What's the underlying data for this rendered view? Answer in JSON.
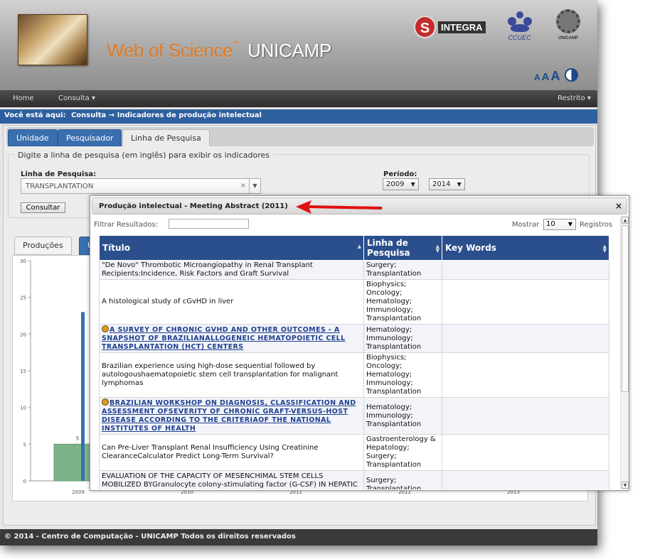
{
  "header": {
    "site_title_part1": "Web of Science",
    "site_title_tm": "™",
    "site_title_part2": "UNICAMP",
    "integra_label": "INTEGRA",
    "integra_letter": "S",
    "ccuec_label": "CCUEC",
    "unicamp_label": "UNICAMP",
    "font_small": "A",
    "font_medium": "A",
    "font_large": "A"
  },
  "nav": {
    "home": "Home",
    "consulta": "Consulta ▾",
    "restrito": "Restrito ▾"
  },
  "breadcrumb": {
    "prefix": "Você está aqui:",
    "path": "Consulta → Indicadores de produção intelectual"
  },
  "tabs": [
    "Unidade",
    "Pesquisador",
    "Linha de Pesquisa"
  ],
  "form": {
    "legend": "Digite a linha de pesquisa (em inglês) para exibir os indicadores",
    "linha_label": "Linha de Pesquisa:",
    "linha_value": "TRANSPLANTATION",
    "periodo_label": "Período:",
    "year_from": "2009",
    "year_to": "2014",
    "consultar_label": "Consultar",
    "clear_glyph": "×",
    "dropdown_glyph": "▼"
  },
  "chart_tabs": {
    "producoes": "Produções",
    "partial": "U"
  },
  "chart_data": {
    "type": "bar",
    "categories": [
      "2009",
      "2010",
      "2011",
      "2012",
      "2013"
    ],
    "values": [
      5,
      null,
      null,
      null,
      null
    ],
    "value_labels": [
      "5",
      "",
      "",
      "",
      ""
    ],
    "ylim": [
      0,
      30
    ],
    "yticks": [
      0,
      5,
      10,
      15,
      20,
      25,
      30
    ],
    "bar_color": "#7db38a",
    "grid": false
  },
  "footer": {
    "text": "© 2014 - Centro de Computação - UNICAMP Todos os direitos reservados"
  },
  "modal": {
    "title": "Produção intelectual - Meeting Abstract (2011)",
    "close": "×",
    "filter_label": "Filtrar Resultados:",
    "filter_value": "",
    "mostrar_label": "Mostrar",
    "mostrar_value": "10",
    "registros_label": "Registros",
    "columns": [
      "Título",
      "Linha de Pesquisa",
      "Key Words"
    ],
    "rows": [
      {
        "title": "\"De Novo\" Thrombotic Microangiopathy in Renal Transplant Recipients:Incidence, Risk Factors and Graft Survival",
        "linha": "Surgery; Transplantation",
        "keywords": "",
        "link": false
      },
      {
        "title": "A histological study of cGvHD in liver",
        "linha": "Biophysics; Oncology; Hematology; Immunology; Transplantation",
        "keywords": "",
        "link": false
      },
      {
        "title": "A SURVEY OF CHRONIC GVHD AND OTHER OUTCOMES - A SNAPSHOT OF BRAZILIANALLOGENEIC HEMATOPOIETIC CELL TRANSPLANTATION (HCT) CENTERS",
        "linha": "Hematology; Immunology; Transplantation",
        "keywords": "",
        "link": true
      },
      {
        "title": "Brazilian experience using high-dose sequential followed by autologoushaematopoietic stem cell transplantation for malignant lymphomas",
        "linha": "Biophysics; Oncology; Hematology; Immunology; Transplantation",
        "keywords": "",
        "link": false
      },
      {
        "title": "BRAZILIAN WORKSHOP ON DIAGNOSIS, CLASSIFICATION AND ASSESSMENT OFSEVERITY OF CHRONIC GRAFT-VERSUS-HOST DISEASE ACCORDING TO THE CRITERIAOF THE NATIONAL INSTITUTES OF HEALTH",
        "linha": "Hematology; Immunology; Transplantation",
        "keywords": "",
        "link": true
      },
      {
        "title": "Can Pre-Liver Transplant Renal Insufficiency Using Creatinine ClearanceCalculator Predict Long-Term Survival?",
        "linha": "Gastroenterology & Hepatology; Surgery; Transplantation",
        "keywords": "",
        "link": false
      },
      {
        "title": "EVALUATION OF THE CAPACITY OF MESENCHIMAL STEM CELLS MOBILIZED BYGranulocyte colony-stimulating factor (G-CSF) IN HEPATIC REGENERATION INPATIENTS SUBMITTED TO",
        "linha": "Surgery; Transplantation",
        "keywords": "",
        "link": false
      }
    ]
  },
  "colors": {
    "accent_blue": "#2b4f8c",
    "breadcrumb_blue": "#2e5f9e",
    "title_orange": "#e07a24",
    "arrow_red": "#e01010"
  }
}
